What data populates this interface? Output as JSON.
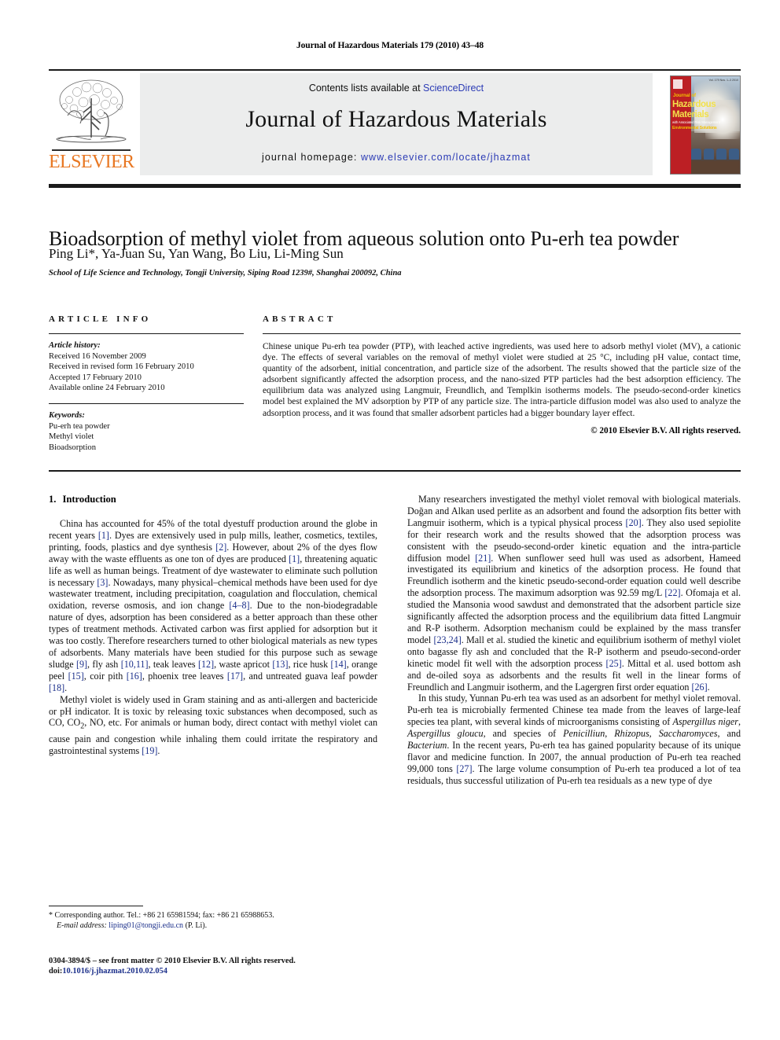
{
  "running_head": "Journal of Hazardous Materials 179 (2010) 43–48",
  "masthead": {
    "contents_prefix": "Contents lists available at ",
    "sciencedirect": "ScienceDirect",
    "journal_title": "Journal of Hazardous Materials",
    "homepage_prefix": "journal homepage: ",
    "homepage_url": "www.elsevier.com/locate/jhazmat",
    "publisher_name": "ELSEVIER",
    "link_color": "#2b3bb5",
    "elsevier_orange": "#e87722",
    "cover": {
      "journal_word": "Journal of",
      "line1": "Hazardous",
      "line2": "Materials",
      "subtitle": "with Associated Risk Management",
      "subtitle2": "Environmental Solutions",
      "issue_info": "Vol. 179 Nos. 1–3 2010"
    }
  },
  "article": {
    "title": "Bioadsorption of methyl violet from aqueous solution onto Pu-erh tea powder",
    "authors": "Ping Li*, Ya-Juan Su, Yan Wang, Bo Liu, Li-Ming Sun",
    "affiliation": "School of Life Science and Technology, Tongji University, Siping Road 1239#, Shanghai 200092, China"
  },
  "article_info": {
    "label": "ARTICLE INFO",
    "history_label": "Article history:",
    "history": [
      "Received 16 November 2009",
      "Received in revised form 16 February 2010",
      "Accepted 17 February 2010",
      "Available online 24 February 2010"
    ],
    "keywords_label": "Keywords:",
    "keywords": [
      "Pu-erh tea powder",
      "Methyl violet",
      "Bioadsorption"
    ]
  },
  "abstract": {
    "label": "ABSTRACT",
    "text": "Chinese unique Pu-erh tea powder (PTP), with leached active ingredients, was used here to adsorb methyl violet (MV), a cationic dye. The effects of several variables on the removal of methyl violet were studied at 25 °C, including pH value, contact time, quantity of the adsorbent, initial concentration, and particle size of the adsorbent. The results showed that the particle size of the adsorbent significantly affected the adsorption process, and the nano-sized PTP particles had the best adsorption efficiency. The equilibrium data was analyzed using Langmuir, Freundlich, and Templkin isotherms models. The pseudo-second-order kinetics model best explained the MV adsorption by PTP of any particle size. The intra-particle diffusion model was also used to analyze the adsorption process, and it was found that smaller adsorbent particles had a bigger boundary layer effect.",
    "copyright": "© 2010 Elsevier B.V. All rights reserved."
  },
  "body": {
    "section_number": "1.",
    "section_title": "Introduction",
    "left_paragraphs": [
      "China has accounted for 45% of the total dyestuff production around the globe in recent years [1]. Dyes are extensively used in pulp mills, leather, cosmetics, textiles, printing, foods, plastics and dye synthesis [2]. However, about 2% of the dyes flow away with the waste effluents as one ton of dyes are produced [1], threatening aquatic life as well as human beings. Treatment of dye wastewater to eliminate such pollution is necessary [3]. Nowadays, many physical–chemical methods have been used for dye wastewater treatment, including precipitation, coagulation and flocculation, chemical oxidation, reverse osmosis, and ion change [4–8]. Due to the non-biodegradable nature of dyes, adsorption has been considered as a better approach than these other types of treatment methods. Activated carbon was first applied for adsorption but it was too costly. Therefore researchers turned to other biological materials as new types of adsorbents. Many materials have been studied for this purpose such as sewage sludge [9], fly ash [10,11], teak leaves [12], waste apricot [13], rice husk [14], orange peel [15], coir pith [16], phoenix tree leaves [17], and untreated guava leaf powder [18].",
      "Methyl violet is widely used in Gram staining and as anti-allergen and bactericide or pH indicator. It is toxic by releasing toxic substances when decomposed, such as CO, CO2, NO, etc. For animals or human body, direct contact with methyl violet can cause pain and congestion while inhaling them could irritate the respiratory and gastrointestinal systems [19]."
    ],
    "right_paragraphs": [
      "Many researchers investigated the methyl violet removal with biological materials. Doğan and Alkan used perlite as an adsorbent and found the adsorption fits better with Langmuir isotherm, which is a typical physical process [20]. They also used sepiolite for their research work and the results showed that the adsorption process was consistent with the pseudo-second-order kinetic equation and the intra-particle diffusion model [21]. When sunflower seed hull was used as adsorbent, Hameed investigated its equilibrium and kinetics of the adsorption process. He found that Freundlich isotherm and the kinetic pseudo-second-order equation could well describe the adsorption process. The maximum adsorption was 92.59 mg/L [22]. Ofomaja et al. studied the Mansonia wood sawdust and demonstrated that the adsorbent particle size significantly affected the adsorption process and the equilibrium data fitted Langmuir and R-P isotherm. Adsorption mechanism could be explained by the mass transfer model [23,24]. Mall et al. studied the kinetic and equilibrium isotherm of methyl violet onto bagasse fly ash and concluded that the R-P isotherm and pseudo-second-order kinetic model fit well with the adsorption process [25]. Mittal et al. used bottom ash and de-oiled soya as adsorbents and the results fit well in the linear forms of Freundlich and Langmuir isotherm, and the Lagergren first order equation [26].",
      "In this study, Yunnan Pu-erh tea was used as an adsorbent for methyl violet removal. Pu-erh tea is microbially fermented Chinese tea made from the leaves of large-leaf species tea plant, with several kinds of microorganisms consisting of Aspergillus niger, Aspergillus gloucu, and species of Penicilliun, Rhizopus, Saccharomyces, and Bacterium. In the recent years, Pu-erh tea has gained popularity because of its unique flavor and medicine function. In 2007, the annual production of Pu-erh tea reached 99,000 tons [27]. The large volume consumption of Pu-erh tea produced a lot of tea residuals, thus successful utilization of Pu-erh tea residuals as a new type of dye"
    ]
  },
  "footnote": {
    "star": "*",
    "corresponding": " Corresponding author. Tel.: +86 21 65981594; fax: +86 21 65988653.",
    "email_label": "E-mail address:",
    "email": "liping01@tongji.edu.cn",
    "email_suffix": " (P. Li)."
  },
  "imprint": {
    "issn_line": "0304-3894/$ – see front matter © 2010 Elsevier B.V. All rights reserved.",
    "doi_label": "doi:",
    "doi": "10.1016/j.jhazmat.2010.02.054"
  }
}
